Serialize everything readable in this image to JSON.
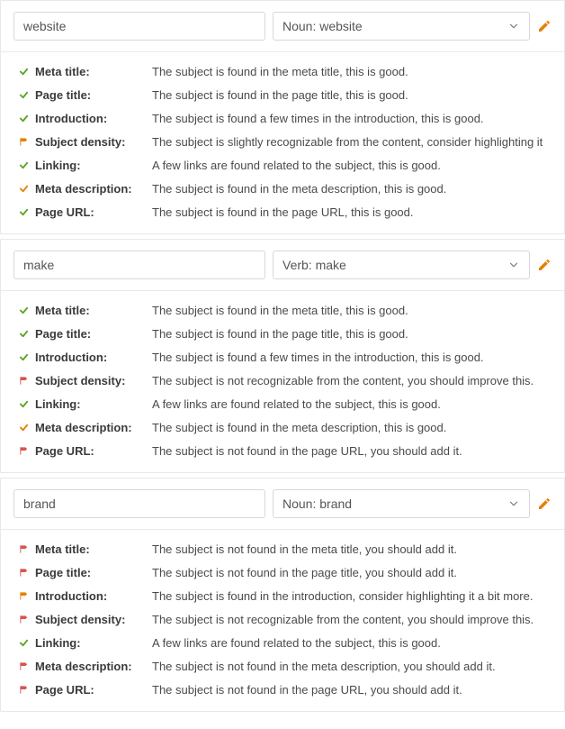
{
  "colors": {
    "good": "#5da423",
    "warn": "#e87e04",
    "bad": "#d9534f"
  },
  "blocks": [
    {
      "subject": "website",
      "type": "Noun: website",
      "checks": [
        {
          "status": "good",
          "label": "Meta title:",
          "desc": "The subject is found in the meta title, this is good."
        },
        {
          "status": "good",
          "label": "Page title:",
          "desc": "The subject is found in the page title, this is good."
        },
        {
          "status": "good",
          "label": "Introduction:",
          "desc": "The subject is found a few times in the introduction, this is good."
        },
        {
          "status": "warn",
          "label": "Subject density:",
          "desc": "The subject is slightly recognizable from the content, consider highlighting it"
        },
        {
          "status": "good",
          "label": "Linking:",
          "desc": "A few links are found related to the subject, this is good."
        },
        {
          "status": "warn-check",
          "label": "Meta description:",
          "desc": "The subject is found in the meta description, this is good."
        },
        {
          "status": "good",
          "label": "Page URL:",
          "desc": "The subject is found in the page URL, this is good."
        }
      ]
    },
    {
      "subject": "make",
      "type": "Verb: make",
      "checks": [
        {
          "status": "good",
          "label": "Meta title:",
          "desc": "The subject is found in the meta title, this is good."
        },
        {
          "status": "good",
          "label": "Page title:",
          "desc": "The subject is found in the page title, this is good."
        },
        {
          "status": "good",
          "label": "Introduction:",
          "desc": "The subject is found a few times in the introduction, this is good."
        },
        {
          "status": "bad",
          "label": "Subject density:",
          "desc": "The subject is not recognizable from the content, you should improve this."
        },
        {
          "status": "good",
          "label": "Linking:",
          "desc": "A few links are found related to the subject, this is good."
        },
        {
          "status": "warn-check",
          "label": "Meta description:",
          "desc": "The subject is found in the meta description, this is good."
        },
        {
          "status": "bad",
          "label": "Page URL:",
          "desc": "The subject is not found in the page URL, you should add it."
        }
      ]
    },
    {
      "subject": "brand",
      "type": "Noun: brand",
      "checks": [
        {
          "status": "bad",
          "label": "Meta title:",
          "desc": "The subject is not found in the meta title, you should add it."
        },
        {
          "status": "bad",
          "label": "Page title:",
          "desc": "The subject is not found in the page title, you should add it."
        },
        {
          "status": "warn",
          "label": "Introduction:",
          "desc": "The subject is found in the introduction, consider highlighting it a bit more."
        },
        {
          "status": "bad",
          "label": "Subject density:",
          "desc": "The subject is not recognizable from the content, you should improve this."
        },
        {
          "status": "good",
          "label": "Linking:",
          "desc": "A few links are found related to the subject, this is good."
        },
        {
          "status": "bad",
          "label": "Meta description:",
          "desc": "The subject is not found in the meta description, you should add it."
        },
        {
          "status": "bad",
          "label": "Page URL:",
          "desc": "The subject is not found in the page URL, you should add it."
        }
      ]
    }
  ]
}
